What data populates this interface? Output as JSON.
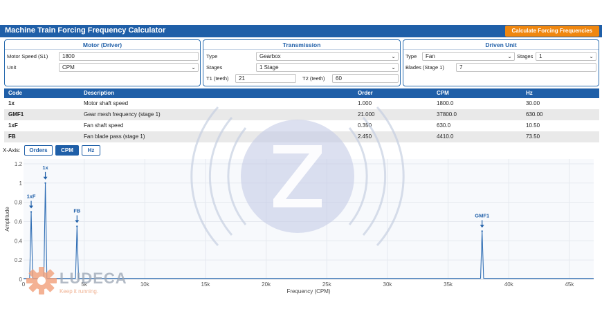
{
  "app": {
    "title": "Machine Train Forcing Frequency Calculator",
    "calculate_button": "Calculate Forcing Frequencies"
  },
  "motor": {
    "header": "Motor (Driver)",
    "speed_label": "Motor Speed (S1)",
    "speed_value": "1800",
    "unit_label": "Unit",
    "unit_value": "CPM"
  },
  "transmission": {
    "header": "Transmission",
    "type_label": "Type",
    "type_value": "Gearbox",
    "stages_label": "Stages",
    "stages_value": "1 Stage",
    "t1_label": "T1 (teeth)",
    "t1_value": "21",
    "t2_label": "T2 (teeth)",
    "t2_value": "60"
  },
  "driven": {
    "header": "Driven Unit",
    "type_label": "Type",
    "type_value": "Fan",
    "stages_label": "Stages",
    "stages_value": "1",
    "blades_label": "Blades (Stage 1)",
    "blades_value": "7"
  },
  "table": {
    "headers": [
      "Code",
      "Description",
      "Order",
      "CPM",
      "Hz"
    ],
    "rows": [
      {
        "code": "1x",
        "description": "Motor shaft speed",
        "order": "1.000",
        "cpm": "1800.0",
        "hz": "30.00"
      },
      {
        "code": "GMF1",
        "description": "Gear mesh frequency (stage 1)",
        "order": "21.000",
        "cpm": "37800.0",
        "hz": "630.00"
      },
      {
        "code": "1xF",
        "description": "Fan shaft speed",
        "order": "0.350",
        "cpm": "630.0",
        "hz": "10.50"
      },
      {
        "code": "FB",
        "description": "Fan blade pass (stage 1)",
        "order": "2.450",
        "cpm": "4410.0",
        "hz": "73.50"
      }
    ]
  },
  "xaxis_selector": {
    "label": "X-Axis:",
    "options": [
      "Orders",
      "CPM",
      "Hz"
    ],
    "selected": "CPM"
  },
  "chart_data": {
    "type": "line",
    "xlabel": "Frequency (CPM)",
    "ylabel": "Amplitude",
    "xlim": [
      0,
      47000
    ],
    "ylim": [
      0,
      1.25
    ],
    "x_ticks": [
      0,
      5000,
      10000,
      15000,
      20000,
      25000,
      30000,
      35000,
      40000,
      45000
    ],
    "x_tick_labels": [
      "0",
      "5k",
      "10k",
      "15k",
      "20k",
      "25k",
      "30k",
      "35k",
      "40k",
      "45k"
    ],
    "y_ticks": [
      0,
      0.2,
      0.4,
      0.6,
      0.8,
      1,
      1.2
    ],
    "y_tick_labels": [
      "0",
      "0.2",
      "0.4",
      "0.6",
      "0.8",
      "1",
      "1.2"
    ],
    "grid": true,
    "line_color": "#2e6db4",
    "peaks": [
      {
        "label": "1xF",
        "x": 630,
        "y": 0.7
      },
      {
        "label": "1x",
        "x": 1800,
        "y": 1.0
      },
      {
        "label": "FB",
        "x": 4410,
        "y": 0.55
      },
      {
        "label": "GMF1",
        "x": 37800,
        "y": 0.5
      }
    ]
  },
  "branding": {
    "logo_text": "LUDECA",
    "tagline": "Keep it running."
  },
  "colors": {
    "primary": "#1f5fa8",
    "accent": "#f0870f"
  }
}
